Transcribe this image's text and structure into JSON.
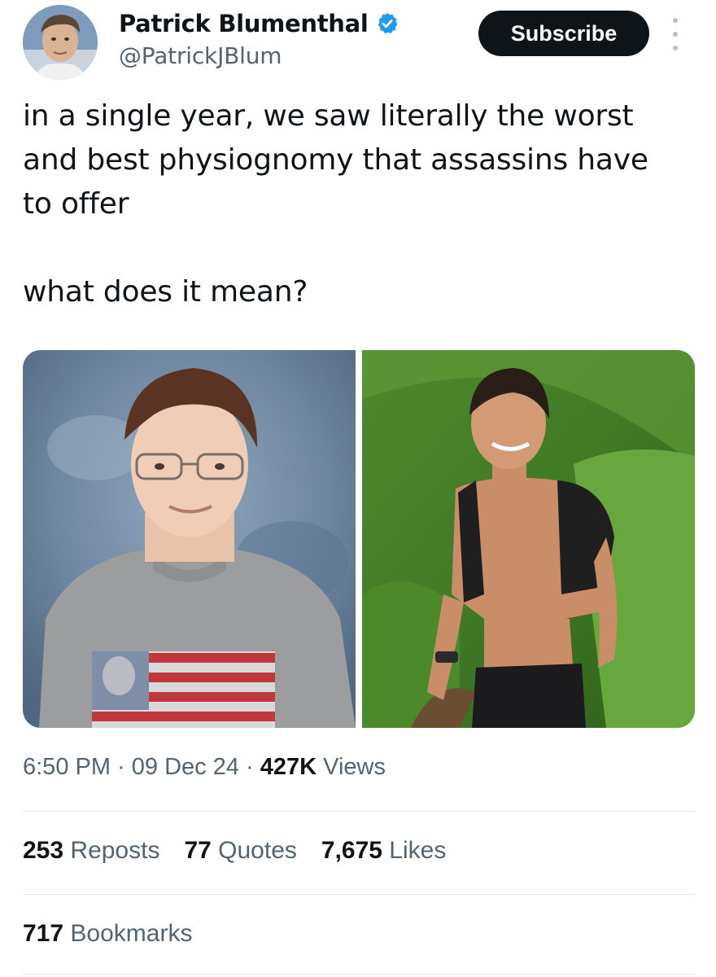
{
  "author": {
    "display_name": "Patrick Blumenthal",
    "handle": "@PatrickJBlum",
    "verified": true,
    "verified_color": "#1d9bf0"
  },
  "actions": {
    "subscribe_label": "Subscribe"
  },
  "tweet": {
    "text": "in a single year, we saw literally the worst\nand best physiognomy that assassins have\nto offer\n\nwhat does it mean?"
  },
  "meta": {
    "time": "6:50 PM",
    "separator": " · ",
    "date": "09 Dec 24",
    "views_count": "427K",
    "views_label": " Views"
  },
  "stats": {
    "reposts_count": "253",
    "reposts_label": " Reposts",
    "quotes_count": "77",
    "quotes_label": " Quotes",
    "likes_count": "7,675",
    "likes_label": " Likes",
    "bookmarks_count": "717",
    "bookmarks_label": " Bookmarks"
  },
  "colors": {
    "text_primary": "#0f1419",
    "text_secondary": "#536471",
    "button_bg": "#0f1419",
    "divider": "#e1e6ea"
  }
}
